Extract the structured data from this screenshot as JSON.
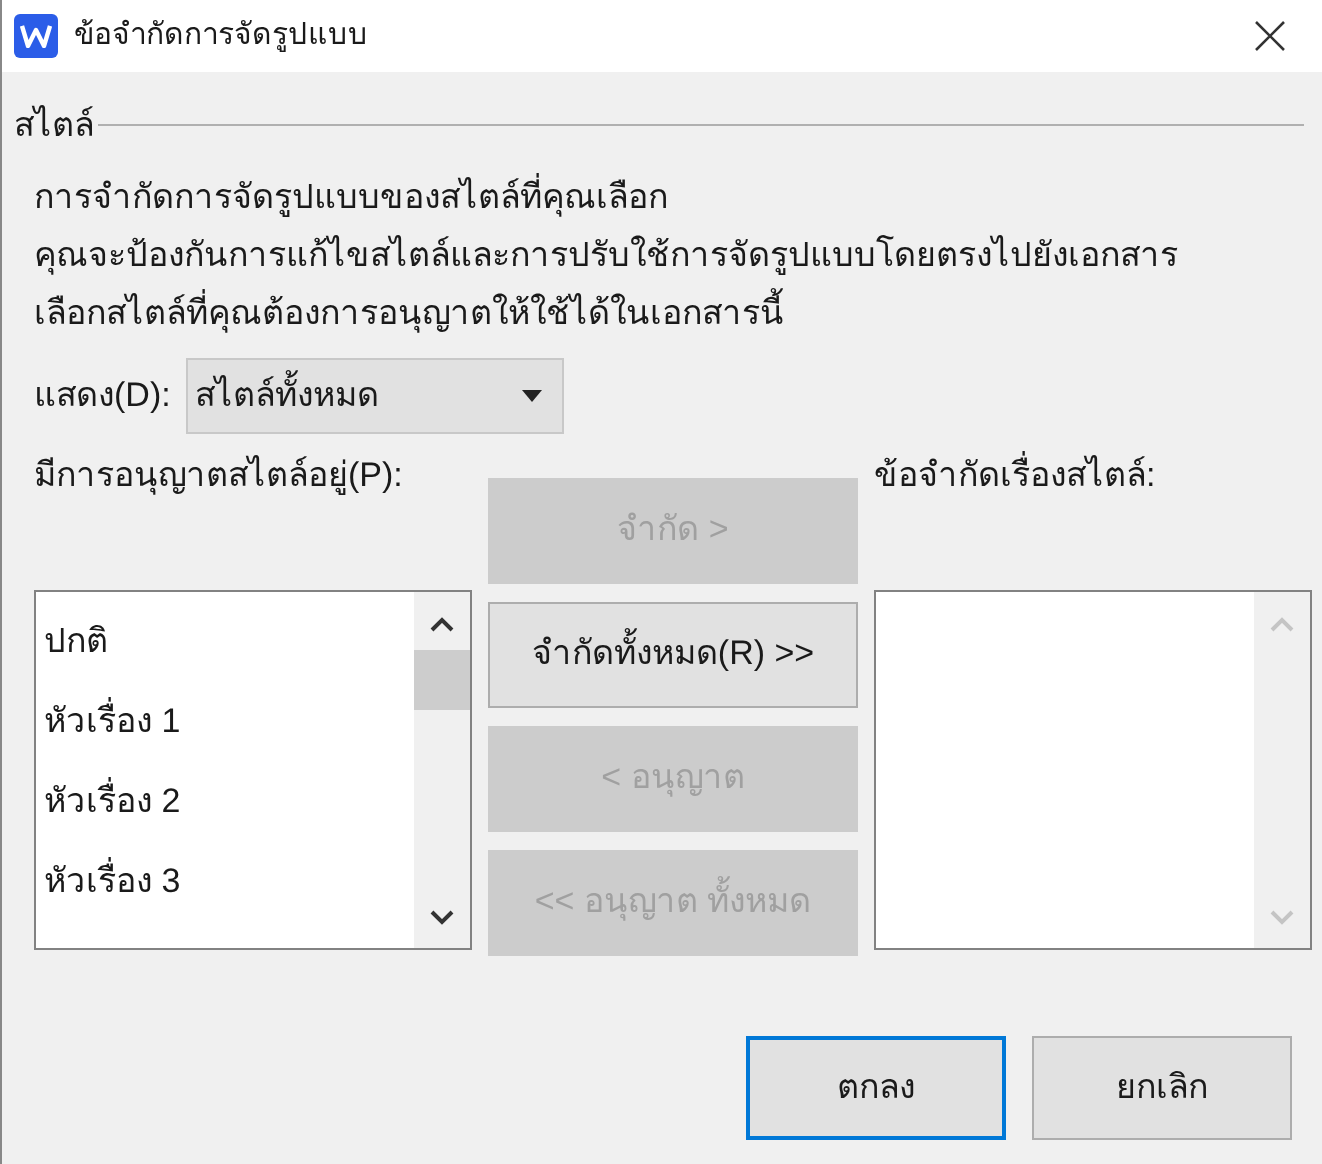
{
  "window": {
    "title": "ข้อจำกัดการจัดรูปแบบ"
  },
  "group": {
    "title": "สไตล์"
  },
  "description": [
    "การจำกัดการจัดรูปแบบของสไตล์ที่คุณเลือก",
    "คุณจะป้องกันการแก้ไขสไตล์และการปรับใช้การจัดรูปแบบโดยตรงไปยังเอกสาร",
    "เลือกสไตล์ที่คุณต้องการอนุญาตให้ใช้ได้ในเอกสารนี้"
  ],
  "show": {
    "label": "แสดง(D):",
    "value": "สไตล์ทั้งหมด"
  },
  "allowed": {
    "label": "มีการอนุญาตสไตล์อยู่(P):",
    "items": [
      "ปกติ",
      "หัวเรื่อง 1",
      "หัวเรื่อง 2",
      "หัวเรื่อง 3"
    ],
    "disabled": false
  },
  "restricted": {
    "label": "ข้อจำกัดเรื่องสไตล์:",
    "disabled": true
  },
  "move_buttons": [
    {
      "label": "จำกัด >",
      "disabled": true
    },
    {
      "label": "จำกัดทั้งหมด(R) >>",
      "disabled": false
    },
    {
      "label": "< อนุญาต",
      "disabled": true
    },
    {
      "label": "<< อนุญาต ทั้งหมด",
      "disabled": true
    }
  ],
  "buttons": [
    {
      "label": "ตกลง",
      "default": true
    },
    {
      "label": "ยกเลิก",
      "default": false
    }
  ]
}
